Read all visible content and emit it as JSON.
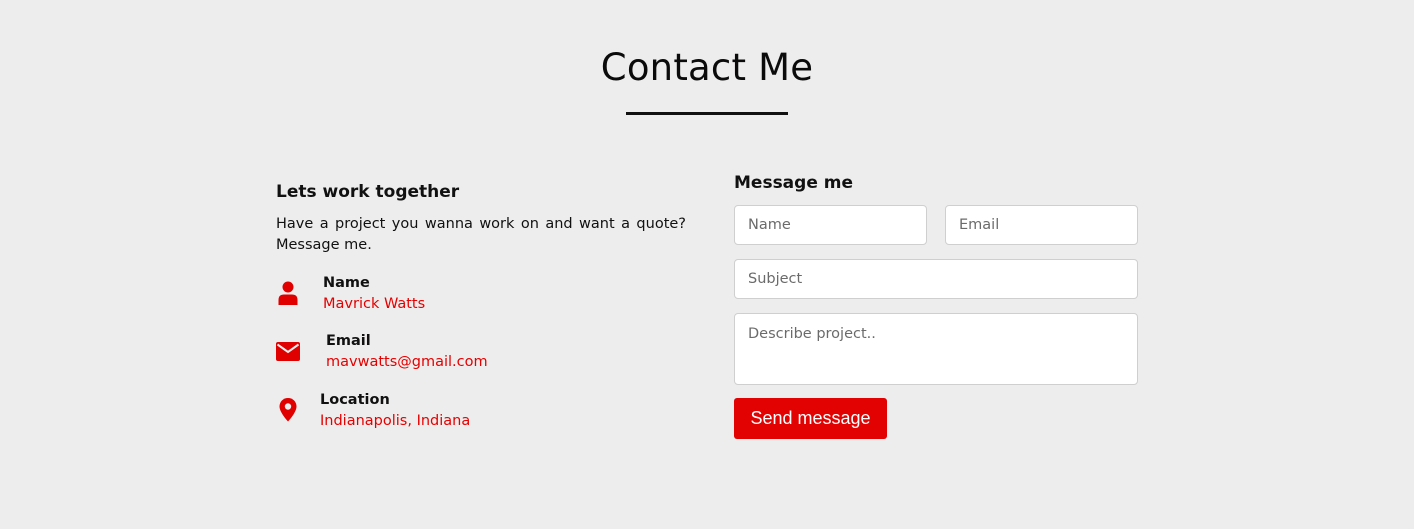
{
  "page": {
    "title": "Contact Me"
  },
  "left": {
    "heading": "Lets work together",
    "description": "Have a project you wanna work on and want a quote? Message me.",
    "items": [
      {
        "icon": "person-icon",
        "label": "Name",
        "value": "Mavrick Watts"
      },
      {
        "icon": "envelope-icon",
        "label": "Email",
        "value": "mavwatts@gmail.com"
      },
      {
        "icon": "map-pin-icon",
        "label": "Location",
        "value": "Indianapolis, Indiana"
      }
    ]
  },
  "form": {
    "heading": "Message me",
    "name_placeholder": "Name",
    "email_placeholder": "Email",
    "subject_placeholder": "Subject",
    "message_placeholder": "Describe project..",
    "submit_label": "Send message"
  },
  "colors": {
    "accent": "#e60000",
    "background": "#eeeded"
  }
}
